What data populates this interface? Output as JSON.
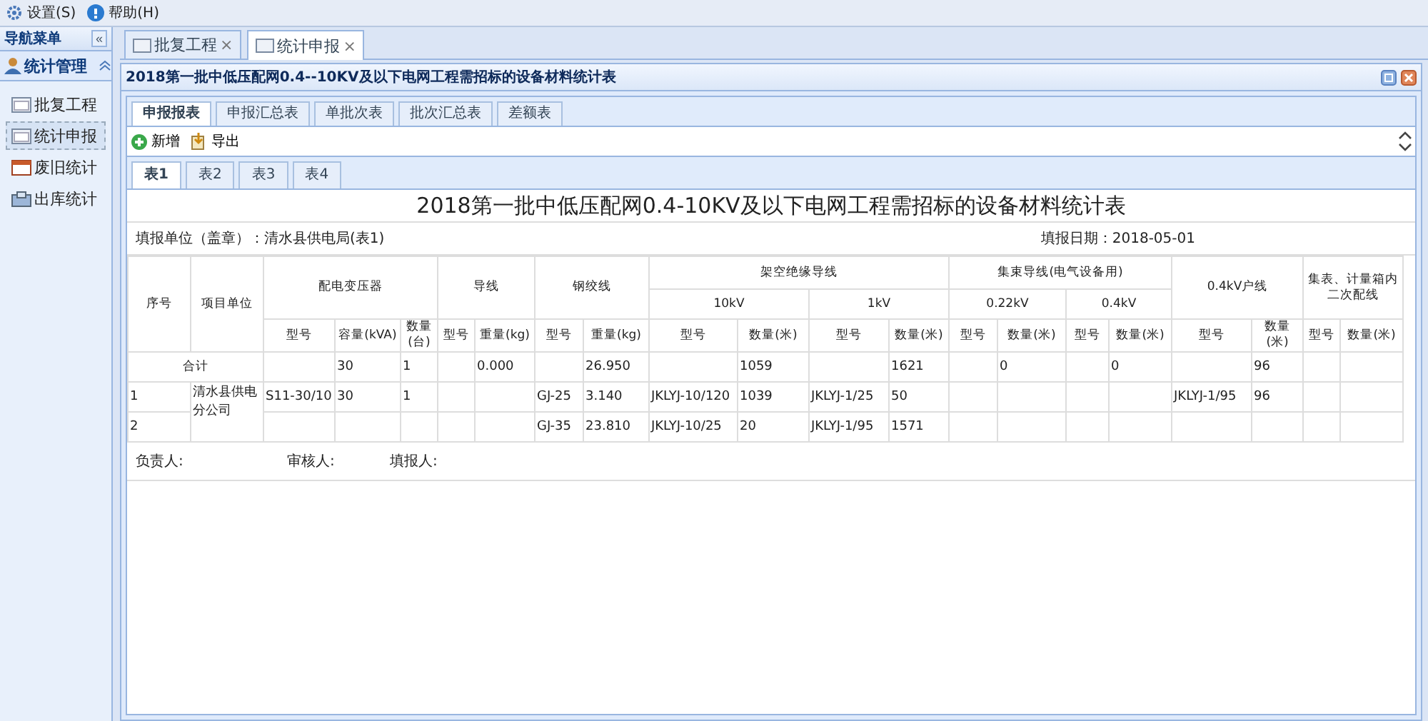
{
  "menu": [
    {
      "label": "设置(S)",
      "kind": "gear"
    },
    {
      "label": "帮助(H)",
      "kind": "help"
    }
  ],
  "sidebar": {
    "title": "导航菜单",
    "collapse": "«",
    "group": {
      "label": "统计管理",
      "expanded": true
    },
    "items": [
      {
        "label": "批复工程",
        "selected": false,
        "kind": "doc"
      },
      {
        "label": "统计申报",
        "selected": true,
        "kind": "doc"
      },
      {
        "label": "废旧统计",
        "selected": false,
        "kind": "calendar"
      },
      {
        "label": "出库统计",
        "selected": false,
        "kind": "box"
      }
    ]
  },
  "tabs": [
    {
      "label": "批复工程",
      "selected": false,
      "close": "×"
    },
    {
      "label": "统计申报",
      "selected": true,
      "close": "×"
    }
  ],
  "panel": {
    "title": "2018第一批中低压配网0.4--10KV及以下电网工程需招标的设备材料统计表"
  },
  "report_tabs": [
    {
      "label": "申报报表",
      "selected": true
    },
    {
      "label": "申报汇总表",
      "selected": false
    },
    {
      "label": "单批次表",
      "selected": false
    },
    {
      "label": "批次汇总表",
      "selected": false
    },
    {
      "label": "差额表",
      "selected": false
    }
  ],
  "toolbar": [
    {
      "label": "新增",
      "kind": "add"
    },
    {
      "label": "导出",
      "kind": "export"
    }
  ],
  "sheet_tabs": [
    {
      "label": "表1",
      "selected": true
    },
    {
      "label": "表2",
      "selected": false
    },
    {
      "label": "表3",
      "selected": false
    },
    {
      "label": "表4",
      "selected": false
    }
  ],
  "sheet": {
    "title": "2018第一批中低压配网0.4-10KV及以下电网工程需招标的设备材料统计表",
    "unit": "填报单位（盖章）：清水县供电局(表1)",
    "date": "填报日期：2018-05-01",
    "header_top": [
      "序号",
      "项目单位",
      "配电变压器",
      "导线",
      "钢绞线",
      "架空绝缘导线",
      "集束导线(电气设备用)",
      "0.4kV户线",
      "集表、计量箱内二次配线"
    ],
    "header_mid": [
      "10kV",
      "1kV",
      "0.22kV",
      "0.4kV"
    ],
    "header_low": [
      "型号",
      "容量(kVA)",
      "数量(台)",
      "型号",
      "重量(kg)",
      "型号",
      "重量(kg)",
      "型号",
      "数量(米)",
      "型号",
      "数量(米)",
      "型号",
      "数量(米)",
      "型号",
      "数量(米)",
      "型号",
      "数量(米)",
      "型号",
      "数量(米)"
    ],
    "total": {
      "label": "合计",
      "cells": [
        null,
        "30",
        "1",
        null,
        "0.000",
        null,
        "26.950",
        null,
        "1059",
        null,
        "1621",
        null,
        "0",
        null,
        "0",
        null,
        "96",
        null,
        null
      ]
    },
    "unit_name": "清水县供电分公司",
    "rows": [
      {
        "no": "1",
        "cells": [
          "S11-30/10",
          "30",
          "1",
          null,
          null,
          "GJ-25",
          "3.140",
          "JKLYJ-10/120",
          "1039",
          "JKLYJ-1/25",
          "50",
          null,
          null,
          null,
          null,
          "JKLYJ-1/95",
          "96",
          null,
          null
        ]
      },
      {
        "no": "2",
        "cells": [
          null,
          null,
          null,
          null,
          null,
          "GJ-35",
          "23.810",
          "JKLYJ-10/25",
          "20",
          "JKLYJ-1/95",
          "1571",
          null,
          null,
          null,
          null,
          null,
          null,
          null,
          null
        ]
      }
    ],
    "signatures": [
      "负责人:",
      "审核人:",
      "填报人:"
    ]
  }
}
